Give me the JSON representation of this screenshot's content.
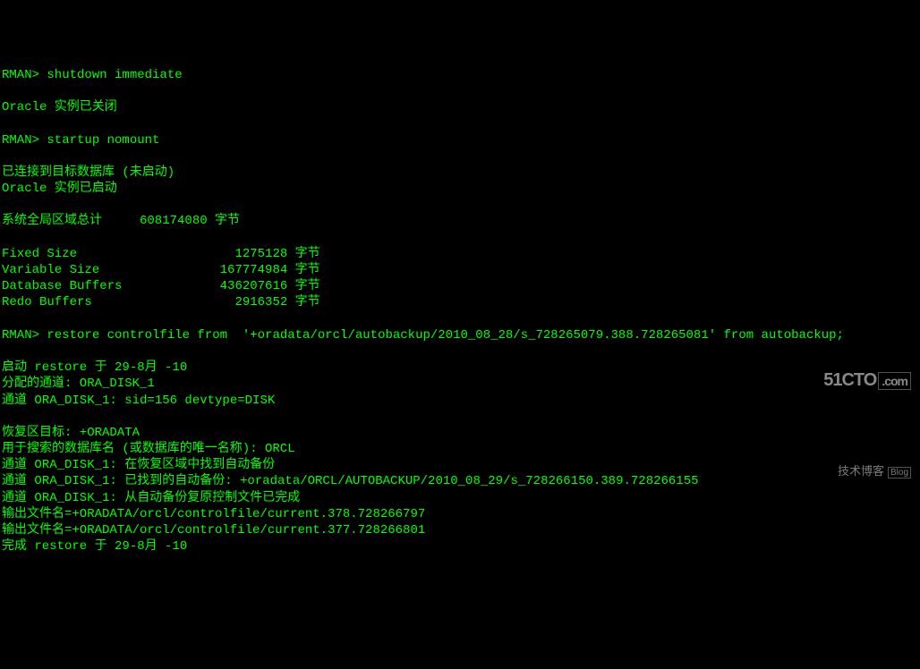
{
  "prompt1": "RMAN> shutdown immediate",
  "blank1": "",
  "msg_oracle_closed": "Oracle 实例已关闭",
  "blank2": "",
  "prompt2": "RMAN> startup nomount",
  "blank3": "",
  "msg_connected": "已连接到目标数据库 (未启动)",
  "msg_oracle_started": "Oracle 实例已启动",
  "blank4": "",
  "sga_total": "系统全局区域总计     608174080 字节",
  "blank5": "",
  "fixed_size": "Fixed Size                     1275128 字节",
  "variable_size": "Variable Size                167774984 字节",
  "database_buffers": "Database Buffers             436207616 字节",
  "redo_buffers": "Redo Buffers                   2916352 字节",
  "blank6": "",
  "prompt3": "RMAN> restore controlfile from  '+oradata/orcl/autobackup/2010_08_28/s_728265079.388.728265081' from autobackup;",
  "blank7": "",
  "restore_start": "启动 restore 于 29-8月 -10",
  "channel_alloc": "分配的通道: ORA_DISK_1",
  "channel_info": "通道 ORA_DISK_1: sid=156 devtype=DISK",
  "blank8": "",
  "recovery_dest": "恢复区目标: +ORADATA",
  "db_name_search": "用于搜索的数据库名 (或数据库的唯一名称): ORCL",
  "channel_found": "通道 ORA_DISK_1: 在恢复区域中找到自动备份",
  "channel_backup": "通道 ORA_DISK_1: 已找到的自动备份: +oradata/ORCL/AUTOBACKUP/2010_08_29/s_728266150.389.728266155",
  "channel_restore_done": "通道 ORA_DISK_1: 从自动备份复原控制文件已完成",
  "output_file1": "输出文件名=+ORADATA/orcl/controlfile/current.378.728266797",
  "output_file2": "输出文件名=+ORADATA/orcl/controlfile/current.377.728266801",
  "restore_done": "完成 restore 于 29-8月 -10",
  "watermark": {
    "domain_main": "51CTO",
    "domain_suffix": ".com",
    "subtitle": "技术博客",
    "blog_label": "Blog"
  }
}
